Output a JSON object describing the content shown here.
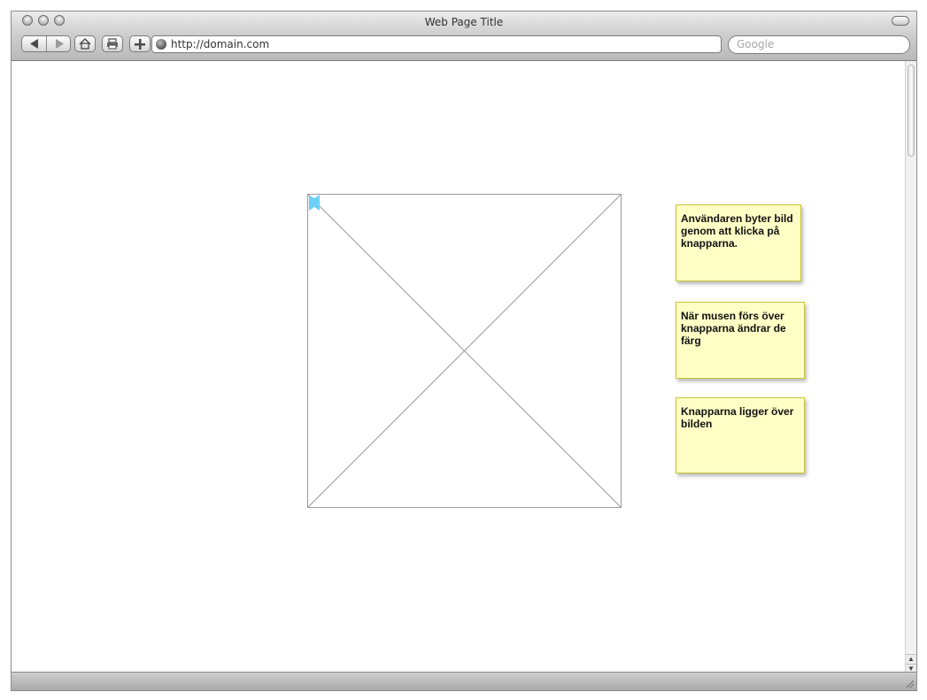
{
  "window": {
    "title": "Web Page Title",
    "url": "http://domain.com",
    "search_placeholder": "Google"
  },
  "toolbar": {
    "back": "back-arrow",
    "forward": "forward-arrow",
    "home": "home-icon",
    "print": "print-icon",
    "add": "plus-icon"
  },
  "slideshow": {
    "image": "image-placeholder",
    "prev_button": "previous-arrow",
    "next_button": "next-arrow",
    "arrow_color": "#6ccff6"
  },
  "notes": [
    {
      "text": "Användaren byter bild genom att klicka på knapparna."
    },
    {
      "text": "När musen förs över knapparna ändrar de färg"
    },
    {
      "text": "Knapparna ligger över bilden"
    }
  ],
  "colors": {
    "note_background": "#ffffc6",
    "note_border": "#c6c63a"
  }
}
